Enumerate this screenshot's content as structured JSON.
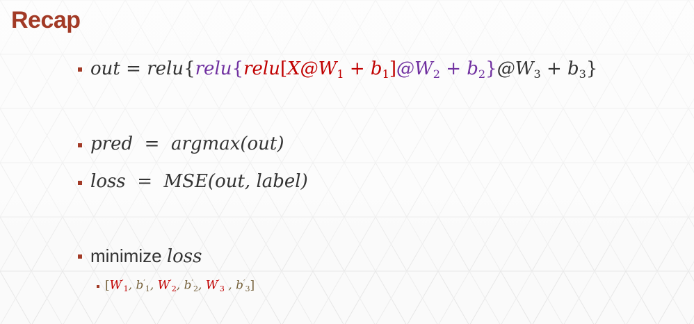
{
  "slide": {
    "title": "Recap"
  },
  "eq_out": {
    "lhs": "out",
    "eq": "=",
    "relu3": "relu",
    "brace_open": "{",
    "relu2": "relu",
    "brace_open2": "{",
    "relu1": "relu",
    "bracket_open": "[",
    "x_w1": "X@W",
    "w1_sub": "1",
    "plus_b1": "+ b",
    "b1_sub": "1",
    "bracket_close": "]",
    "at_w2": "@W",
    "w2_sub": "2",
    "plus_b2": "+ b",
    "b2_sub": "2",
    "brace_close2": "}",
    "at_w3": "@W",
    "w3_sub": "3",
    "plus_b3": "+ b",
    "b3_sub": "3",
    "brace_close": "}"
  },
  "eq_pred": {
    "lhs": "pred",
    "eq": "=",
    "rhs": "argmax(out)"
  },
  "eq_loss": {
    "lhs": "loss",
    "eq": "=",
    "rhs": "MSE(out, label)"
  },
  "minimize": {
    "word": "minimize",
    "target": "loss"
  },
  "params": {
    "open": "[",
    "w1": "W",
    "w1_sup": "′",
    "w1_sub": "1",
    "sep1": ", ",
    "b1": "b",
    "b1_sup": "′",
    "b1_sub": "1",
    "sep2": ", ",
    "w2": "W",
    "w2_sup": "′",
    "w2_sub": "2",
    "sep3": ", ",
    "b2": "b",
    "b2_sup": "′",
    "b2_sub": "2",
    "sep4": ", ",
    "w3": "W",
    "w3_sup": "′",
    "w3_sub": "3",
    "sep5": " , ",
    "b3": "b",
    "b3_sup": "′",
    "b3_sub": "3",
    "close": "]"
  },
  "colors": {
    "title": "#a23a26",
    "red": "#c00000",
    "purple": "#7030a0",
    "dark": "#333333",
    "olive": "#76623c"
  }
}
